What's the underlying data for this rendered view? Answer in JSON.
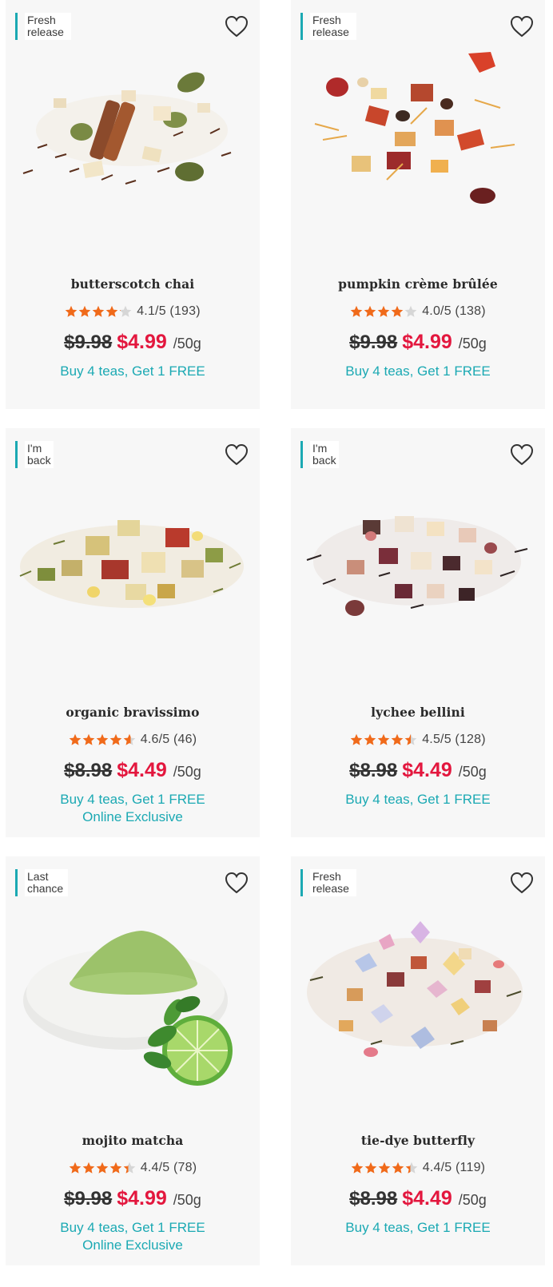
{
  "products": [
    {
      "badge": "Fresh release",
      "name": "butterscotch chai",
      "rating_value": 4.1,
      "rating_text": "4.1/5 (193)",
      "old_price": "$9.98",
      "new_price": "$4.99",
      "unit": "/50g",
      "promo": [
        "Buy 4 teas, Get 1 FREE"
      ]
    },
    {
      "badge": "Fresh release",
      "name": "pumpkin crème brûlée",
      "rating_value": 4.0,
      "rating_text": "4.0/5 (138)",
      "old_price": "$9.98",
      "new_price": "$4.99",
      "unit": "/50g",
      "promo": [
        "Buy 4 teas, Get 1 FREE"
      ]
    },
    {
      "badge": "I'm back",
      "name": "organic bravissimo",
      "rating_value": 4.6,
      "rating_text": "4.6/5 (46)",
      "old_price": "$8.98",
      "new_price": "$4.49",
      "unit": "/50g",
      "promo": [
        "Buy 4 teas, Get 1 FREE",
        "Online Exclusive"
      ]
    },
    {
      "badge": "I'm back",
      "name": "lychee bellini",
      "rating_value": 4.5,
      "rating_text": "4.5/5 (128)",
      "old_price": "$8.98",
      "new_price": "$4.49",
      "unit": "/50g",
      "promo": [
        "Buy 4 teas, Get 1 FREE"
      ]
    },
    {
      "badge": "Last chance",
      "name": "mojito matcha",
      "rating_value": 4.4,
      "rating_text": "4.4/5 (78)",
      "old_price": "$9.98",
      "new_price": "$4.99",
      "unit": "/50g",
      "promo": [
        "Buy 4 teas, Get 1 FREE",
        "Online Exclusive"
      ]
    },
    {
      "badge": "Fresh release",
      "name": "tie-dye butterfly",
      "rating_value": 4.4,
      "rating_text": "4.4/5 (119)",
      "old_price": "$8.98",
      "new_price": "$4.49",
      "unit": "/50g",
      "promo": [
        "Buy 4 teas, Get 1 FREE"
      ]
    }
  ],
  "colors": {
    "accent_teal": "#1ba9b3",
    "sale_red": "#e3173e",
    "star_orange": "#f06a1a",
    "star_empty": "#d6d6d6"
  },
  "icons": {
    "favorite": "heart-outline-icon",
    "rating": "star-icon"
  }
}
